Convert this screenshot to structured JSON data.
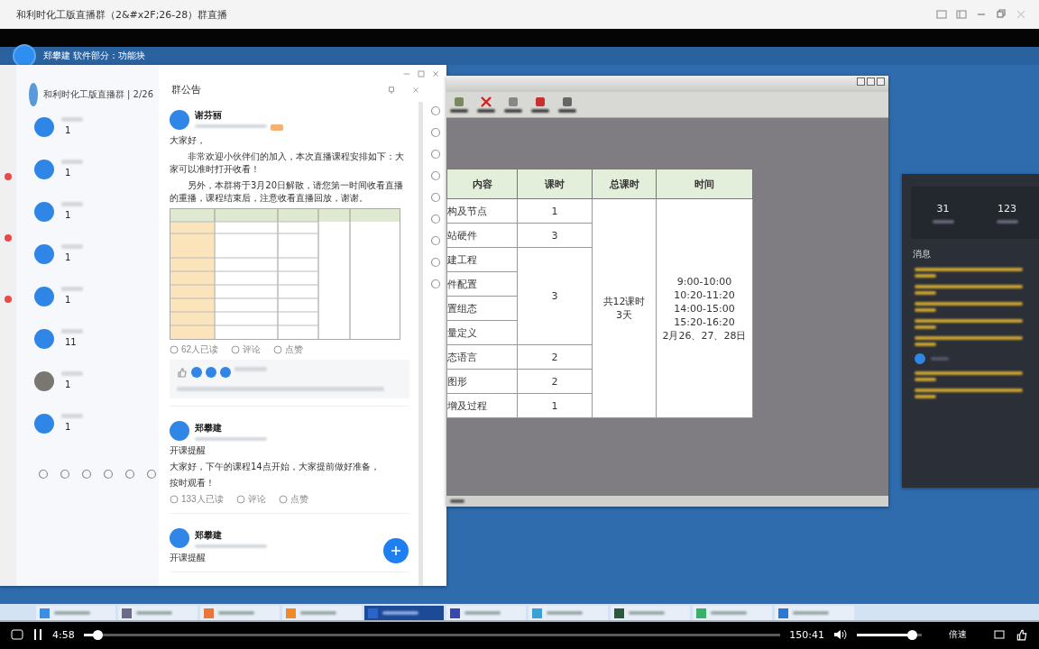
{
  "app_title": "和利时化工版直播群（2&#x2F;26-28）群直播",
  "presenter": {
    "line": "郑攀建 软件部分：功能块"
  },
  "chat": {
    "group_name": "和利时化工版直播群 | 2/26",
    "contacts": [
      {
        "kind": "avatar",
        "count": "1"
      },
      {
        "kind": "avatar",
        "count": "1"
      },
      {
        "kind": "avatar",
        "count": "1"
      },
      {
        "kind": "avatar",
        "count": "1"
      },
      {
        "kind": "avatar",
        "count": "1"
      },
      {
        "kind": "avatar",
        "count": "11"
      },
      {
        "kind": "photo",
        "count": "1"
      },
      {
        "kind": "avatar",
        "count": "1"
      }
    ],
    "panel_title": "群公告",
    "posts": [
      {
        "author": "谢芬丽",
        "tagged": true,
        "paragraphs": [
          "大家好，",
          "非常欢迎小伙伴们的加入，本次直播课程安排如下：大家可以准时打开收看！",
          "另外，本群将于3月20日解散，请您第一时间收看直播的重播，课程结束后，注意收看直播回放，谢谢。"
        ],
        "has_image": true,
        "actions": [
          "62人已读",
          "评论",
          "点赞"
        ],
        "has_replies": true
      },
      {
        "author": "郑攀建",
        "paragraphs": [
          "开课提醒",
          "大家好，下午的课程14点开始，大家提前做好准备，",
          "按时观看！"
        ],
        "actions": [
          "133人已读",
          "评论",
          "点赞"
        ]
      },
      {
        "author": "郑攀建",
        "paragraphs": [
          "开课提醒"
        ]
      }
    ]
  },
  "schedule": {
    "columns": [
      "内容",
      "课时",
      "总课时",
      "时间"
    ],
    "groups": [
      {
        "hours": "1",
        "topics": [
          "构及节点"
        ]
      },
      {
        "hours": "3",
        "topics": [
          "站硬件"
        ]
      },
      {
        "hours": "3",
        "topics": [
          "建工程",
          "件配置",
          "置组态",
          "量定义"
        ]
      },
      {
        "hours": "2",
        "topics": [
          "态语言"
        ]
      },
      {
        "hours": "2",
        "topics": [
          "图形"
        ]
      },
      {
        "hours": "1",
        "topics": [
          "增及过程"
        ]
      }
    ],
    "total": [
      "共12课时",
      "3天"
    ],
    "times": [
      "9:00-10:00",
      "10:20-11:20",
      "14:00-15:00",
      "15:20-16:20",
      "2月26、27、28日"
    ]
  },
  "side_panel": {
    "stats": [
      "31",
      "123"
    ],
    "heading": "消息"
  },
  "taskbar": [
    {
      "color": "#3a8ee6",
      "selected": false
    },
    {
      "color": "#6a6a8a",
      "selected": false
    },
    {
      "color": "#e8763a",
      "selected": false
    },
    {
      "color": "#f08a24",
      "selected": false
    },
    {
      "color": "#2a66c8",
      "selected": true
    },
    {
      "color": "#3848b0",
      "selected": false
    },
    {
      "color": "#3aa0d8",
      "selected": false
    },
    {
      "color": "#2a5a3a",
      "selected": false
    },
    {
      "color": "#3ab06a",
      "selected": false
    },
    {
      "color": "#2a78d8",
      "selected": false
    }
  ],
  "player": {
    "elapsed": "4:58",
    "duration": "150:41",
    "progress": {
      "level": 0.02
    },
    "volume": {
      "level": 0.85
    },
    "speed_label": "倍速"
  }
}
